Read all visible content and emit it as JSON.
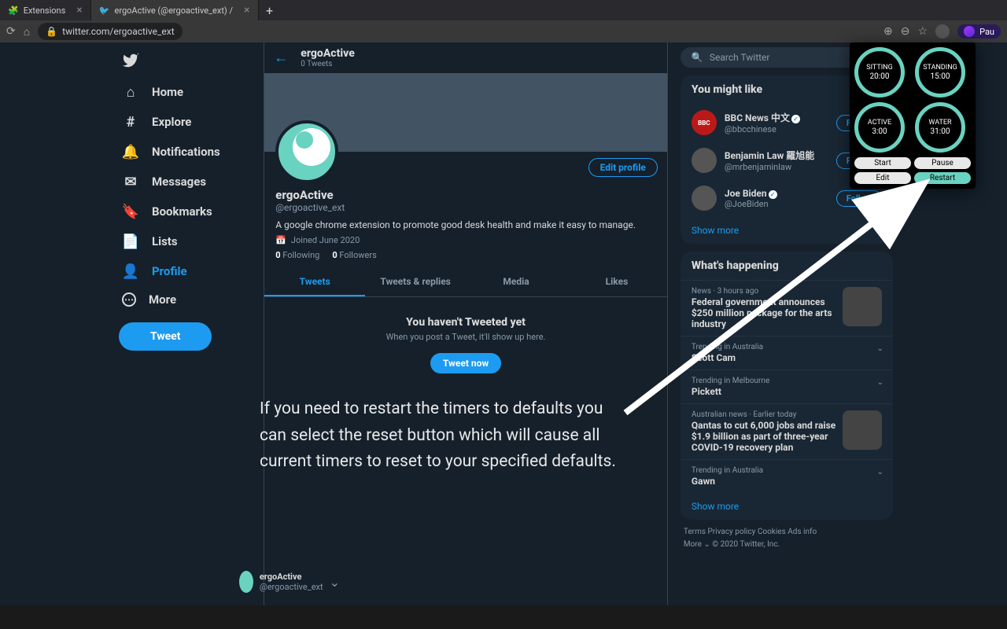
{
  "browser": {
    "tabs": [
      {
        "label": "Extensions",
        "icon": "🧩"
      },
      {
        "label": "ergoActive (@ergoactive_ext) /",
        "icon": "tw"
      }
    ],
    "url_lock": "🔒",
    "url": "twitter.com/ergoactive_ext",
    "user_label": "Pau"
  },
  "nav": {
    "items": [
      {
        "label": "Home",
        "icon": "⌂"
      },
      {
        "label": "Explore",
        "icon": "#"
      },
      {
        "label": "Notifications",
        "icon": "🔔"
      },
      {
        "label": "Messages",
        "icon": "✉"
      },
      {
        "label": "Bookmarks",
        "icon": "🔖"
      },
      {
        "label": "Lists",
        "icon": "📄"
      },
      {
        "label": "Profile",
        "icon": "👤"
      },
      {
        "label": "More",
        "icon": "⋯"
      }
    ],
    "tweet": "Tweet"
  },
  "header": {
    "name": "ergoActive",
    "sub": "0 Tweets"
  },
  "profile": {
    "name": "ergoActive",
    "handle": "@ergoactive_ext",
    "edit": "Edit profile",
    "bio": "A google chrome extension to promote good desk health and make it easy to manage.",
    "joined": "Joined June 2020",
    "following_n": "0",
    "following": "Following",
    "followers_n": "0",
    "followers": "Followers",
    "tabs": [
      "Tweets",
      "Tweets & replies",
      "Media",
      "Likes"
    ],
    "empty_title": "You haven't Tweeted yet",
    "empty_sub": "When you post a Tweet, it'll show up here.",
    "tweet_now": "Tweet now"
  },
  "search": {
    "placeholder": "Search Twitter"
  },
  "suggestions": {
    "title": "You might like",
    "items": [
      {
        "name": "BBC News 中文",
        "verified": true,
        "handle": "@bbcchinese",
        "av": "BBC"
      },
      {
        "name": "Benjamin Law 羅旭能",
        "verified": false,
        "handle": "@mrbenjaminlaw",
        "av": ""
      },
      {
        "name": "Joe Biden",
        "verified": true,
        "handle": "@JoeBiden",
        "av": ""
      }
    ],
    "follow": "Follow",
    "more": "Show more"
  },
  "happening": {
    "title": "What's happening",
    "items": [
      {
        "cat": "News · 3 hours ago",
        "title": "Federal government announces $250 million package for the arts industry",
        "img": true
      },
      {
        "cat": "Trending in Australia",
        "title": "Scott Cam"
      },
      {
        "cat": "Trending in Melbourne",
        "title": "Pickett"
      },
      {
        "cat": "Australian news · Earlier today",
        "title": "Qantas to cut 6,000 jobs and raise $1.9 billion as part of three-year COVID-19 recovery plan",
        "img": true
      },
      {
        "cat": "Trending in Australia",
        "title": "Gawn"
      }
    ],
    "more": "Show more"
  },
  "footer": {
    "l1": "Terms   Privacy policy   Cookies   Ads info",
    "l2": "More ⌄   © 2020 Twitter, Inc."
  },
  "account": {
    "name": "ergoActive",
    "handle": "@ergoactive_ext"
  },
  "ext": {
    "rings": [
      {
        "label": "SITTING",
        "val": "20:00"
      },
      {
        "label": "STANDING",
        "val": "15:00"
      },
      {
        "label": "ACTIVE",
        "val": "3:00"
      },
      {
        "label": "WATER",
        "val": "31:00"
      }
    ],
    "btns": [
      "Start",
      "Pause",
      "Edit",
      "Restart"
    ]
  },
  "annotation": "If you need to restart the timers to defaults you can select the reset button which will cause all current timers to reset to your specified defaults."
}
